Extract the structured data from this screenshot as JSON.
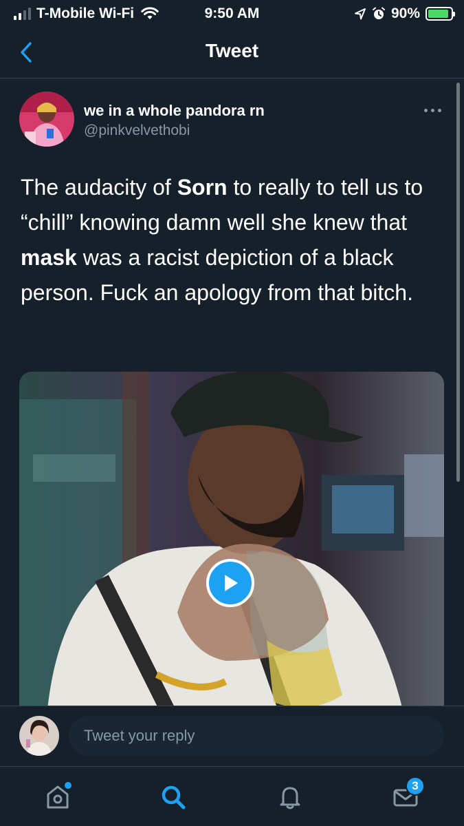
{
  "status_bar": {
    "carrier": "T-Mobile Wi-Fi",
    "time": "9:50 AM",
    "battery_percent": "90%",
    "battery_level": 0.9,
    "icons": [
      "signal-icon",
      "wifi-icon",
      "location-icon",
      "alarm-icon",
      "battery-charging-icon"
    ]
  },
  "nav": {
    "title": "Tweet",
    "back_icon": "chevron-left-icon"
  },
  "tweet": {
    "display_name": "we in a whole pandora rn",
    "handle": "@pinkvelvethobi",
    "more_icon": "more-horizontal-icon",
    "text_segments": {
      "s1": "The audacity of ",
      "b1": "Sorn",
      "s2": " to really to tell us to “chill” knowing damn well she knew that ",
      "b2": "mask",
      "s3": " was a racist depiction of a black person. Fuck an apology from that bitch."
    },
    "media": {
      "type": "video",
      "play_icon": "play-icon"
    }
  },
  "reply": {
    "placeholder": "Tweet your reply"
  },
  "tab_bar": {
    "tabs": [
      {
        "name": "home",
        "icon": "home-icon",
        "has_dot": true
      },
      {
        "name": "search",
        "icon": "search-icon",
        "active": true
      },
      {
        "name": "notifications",
        "icon": "bell-icon"
      },
      {
        "name": "messages",
        "icon": "mail-icon"
      }
    ],
    "messages_badge": "3"
  },
  "colors": {
    "background": "#15202b",
    "accent": "#1da1f2",
    "secondary_text": "#8899a6",
    "divider": "#38444d",
    "battery_fill": "#4cd964"
  }
}
